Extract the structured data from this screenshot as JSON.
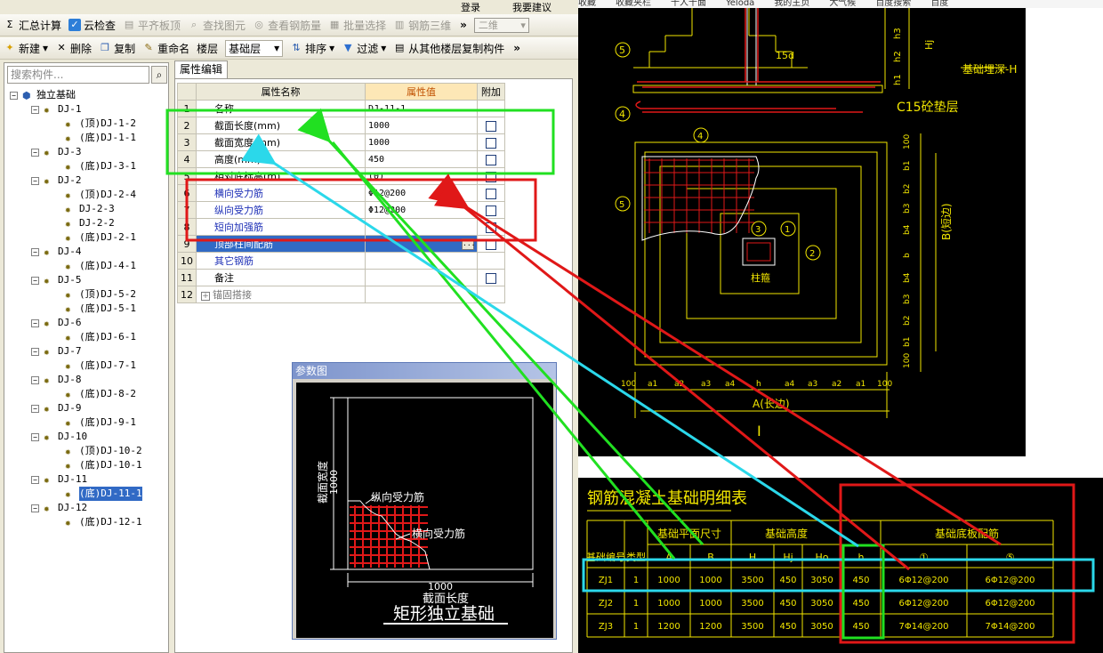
{
  "toolbar1": {
    "items": [
      {
        "icon": "sigma-icon",
        "label": "汇总计算",
        "enabled": true
      },
      {
        "icon": "cloud-check-icon",
        "label": "云检查",
        "enabled": true
      },
      {
        "icon": "level-slab-icon",
        "label": "平齐板顶",
        "enabled": false
      },
      {
        "icon": "find-element-icon",
        "label": "查找图元",
        "enabled": false
      },
      {
        "icon": "view-rebar-icon",
        "label": "查看钢筋量",
        "enabled": false
      },
      {
        "icon": "batch-select-icon",
        "label": "批量选择",
        "enabled": false
      },
      {
        "icon": "rebar-3d-icon",
        "label": "钢筋三维",
        "enabled": false
      }
    ],
    "more": "»",
    "view_mode": "二维"
  },
  "topstrip": {
    "login": "登录",
    "suggest": "我要建议"
  },
  "toolbar2": {
    "new": "新建",
    "delete": "删除",
    "copy": "复制",
    "rename": "重命名",
    "floor_label": "楼层",
    "floor_value": "基础层",
    "sort": "排序",
    "filter": "过滤",
    "copy_from_floor": "从其他楼层复制构件",
    "more": "»"
  },
  "search": {
    "placeholder": "搜索构件..."
  },
  "tree": [
    {
      "label": "独立基础",
      "depth": 0,
      "type": "root",
      "expanded": true
    },
    {
      "label": "DJ-1",
      "depth": 1,
      "type": "group",
      "expanded": true
    },
    {
      "label": "(顶)DJ-1-2",
      "depth": 2,
      "type": "leaf"
    },
    {
      "label": "(底)DJ-1-1",
      "depth": 2,
      "type": "leaf"
    },
    {
      "label": "DJ-3",
      "depth": 1,
      "type": "group",
      "expanded": true
    },
    {
      "label": "(底)DJ-3-1",
      "depth": 2,
      "type": "leaf"
    },
    {
      "label": "DJ-2",
      "depth": 1,
      "type": "group",
      "expanded": true
    },
    {
      "label": "(顶)DJ-2-4",
      "depth": 2,
      "type": "leaf"
    },
    {
      "label": "DJ-2-3",
      "depth": 2,
      "type": "leaf"
    },
    {
      "label": "DJ-2-2",
      "depth": 2,
      "type": "leaf"
    },
    {
      "label": "(底)DJ-2-1",
      "depth": 2,
      "type": "leaf"
    },
    {
      "label": "DJ-4",
      "depth": 1,
      "type": "group",
      "expanded": true
    },
    {
      "label": "(底)DJ-4-1",
      "depth": 2,
      "type": "leaf"
    },
    {
      "label": "DJ-5",
      "depth": 1,
      "type": "group",
      "expanded": true
    },
    {
      "label": "(顶)DJ-5-2",
      "depth": 2,
      "type": "leaf"
    },
    {
      "label": "(底)DJ-5-1",
      "depth": 2,
      "type": "leaf"
    },
    {
      "label": "DJ-6",
      "depth": 1,
      "type": "group",
      "expanded": true
    },
    {
      "label": "(底)DJ-6-1",
      "depth": 2,
      "type": "leaf"
    },
    {
      "label": "DJ-7",
      "depth": 1,
      "type": "group",
      "expanded": true
    },
    {
      "label": "(底)DJ-7-1",
      "depth": 2,
      "type": "leaf"
    },
    {
      "label": "DJ-8",
      "depth": 1,
      "type": "group",
      "expanded": true
    },
    {
      "label": "(底)DJ-8-2",
      "depth": 2,
      "type": "leaf"
    },
    {
      "label": "DJ-9",
      "depth": 1,
      "type": "group",
      "expanded": true
    },
    {
      "label": "(底)DJ-9-1",
      "depth": 2,
      "type": "leaf"
    },
    {
      "label": "DJ-10",
      "depth": 1,
      "type": "group",
      "expanded": true
    },
    {
      "label": "(顶)DJ-10-2",
      "depth": 2,
      "type": "leaf"
    },
    {
      "label": "(底)DJ-10-1",
      "depth": 2,
      "type": "leaf"
    },
    {
      "label": "DJ-11",
      "depth": 1,
      "type": "group",
      "expanded": true
    },
    {
      "label": "(底)DJ-11-1",
      "depth": 2,
      "type": "leaf",
      "selected": true
    },
    {
      "label": "DJ-12",
      "depth": 1,
      "type": "group",
      "expanded": true
    },
    {
      "label": "(底)DJ-12-1",
      "depth": 2,
      "type": "leaf"
    }
  ],
  "property_editor": {
    "tab": "属性编辑",
    "columns": [
      "属性名称",
      "属性值",
      "附加"
    ],
    "rows": [
      {
        "num": "1",
        "name": "名称",
        "value": "DJ-11-1",
        "style": "normal",
        "checkbox": false
      },
      {
        "num": "2",
        "name": "截面长度(mm)",
        "value": "1000",
        "style": "normal",
        "checkbox": true
      },
      {
        "num": "3",
        "name": "截面宽度(mm)",
        "value": "1000",
        "style": "normal",
        "checkbox": true
      },
      {
        "num": "4",
        "name": "高度(mm)",
        "value": "450",
        "style": "normal",
        "checkbox": true
      },
      {
        "num": "5",
        "name": "相对底标高(m)",
        "value": "(0)",
        "style": "normal",
        "checkbox": true
      },
      {
        "num": "6",
        "name": "横向受力筋",
        "value": "Φ12@200",
        "style": "blue",
        "checkbox": true
      },
      {
        "num": "7",
        "name": "纵向受力筋",
        "value": "Φ12@200",
        "style": "blue",
        "checkbox": true
      },
      {
        "num": "8",
        "name": "短向加强筋",
        "value": "",
        "style": "blue",
        "checkbox": true
      },
      {
        "num": "9",
        "name": "顶部柱间配筋",
        "value": "",
        "style": "selected",
        "checkbox": true,
        "ellipsis": "..."
      },
      {
        "num": "10",
        "name": "其它钢筋",
        "value": "",
        "style": "blue",
        "checkbox": false
      },
      {
        "num": "11",
        "name": "备注",
        "value": "",
        "style": "normal",
        "checkbox": true
      },
      {
        "num": "12",
        "name": "锚固搭接",
        "value": "",
        "style": "gray",
        "checkbox": false,
        "expander": "+"
      }
    ]
  },
  "param_diagram": {
    "title": "参数图",
    "width_label": "截面宽度",
    "width_value": "1000",
    "length_label": "截面长度",
    "length_value": "1000",
    "longitudinal_label": "纵向受力筋",
    "transverse_label": "横向受力筋",
    "caption": "矩形独立基础"
  },
  "browser_bar": {
    "tabs": [
      "收藏",
      "收藏夹栏",
      "千人千面",
      "Yeloda",
      "我的主页",
      "大气候",
      "百度搜索",
      "百度"
    ]
  },
  "cad_drawing": {
    "labels": {
      "callout_5": "5",
      "callout_4": "4",
      "callout_3": "3",
      "callout_2": "2",
      "callout_1": "1",
      "anchor_15d": "15d",
      "depth_label": "基础埋深-H",
      "cushion": "C15砼垫层",
      "h1": "h1",
      "h2": "h2",
      "h3": "h3",
      "hj": "Hj",
      "column_label": "柱箍",
      "width_dir": "B(短边)",
      "length_dir": "A(长边)",
      "dim_100": "100",
      "dim_a1": "a1",
      "dim_a2": "a2",
      "dim_a3": "a3",
      "dim_a4": "a4",
      "dim_h": "h",
      "dim_b": "b",
      "dim_b1": "b1",
      "dim_b2": "b2",
      "dim_b3": "b3",
      "dim_b4": "b4",
      "section_mark": "I"
    }
  },
  "detail_table": {
    "title": "钢筋混凝土基础明细表",
    "group_headers": [
      "基础平面尺寸",
      "基础高度",
      "基础底板配筋"
    ],
    "headers": [
      "基础编号",
      "类型",
      "A",
      "B",
      "H",
      "Hj",
      "Ho",
      "h",
      "①",
      "⑤"
    ],
    "rows": [
      [
        "ZJ1",
        "1",
        "1000",
        "1000",
        "3500",
        "450",
        "3050",
        "450",
        "6Φ12@200",
        "6Φ12@200"
      ],
      [
        "ZJ2",
        "1",
        "1000",
        "1000",
        "3500",
        "450",
        "3050",
        "450",
        "6Φ12@200",
        "6Φ12@200"
      ],
      [
        "ZJ3",
        "1",
        "1200",
        "1200",
        "3500",
        "450",
        "3050",
        "450",
        "7Φ14@200",
        "7Φ14@200"
      ]
    ]
  },
  "annotation_colors": {
    "green": "#21e021",
    "cyan": "#2bd8ea",
    "red": "#e01818"
  }
}
